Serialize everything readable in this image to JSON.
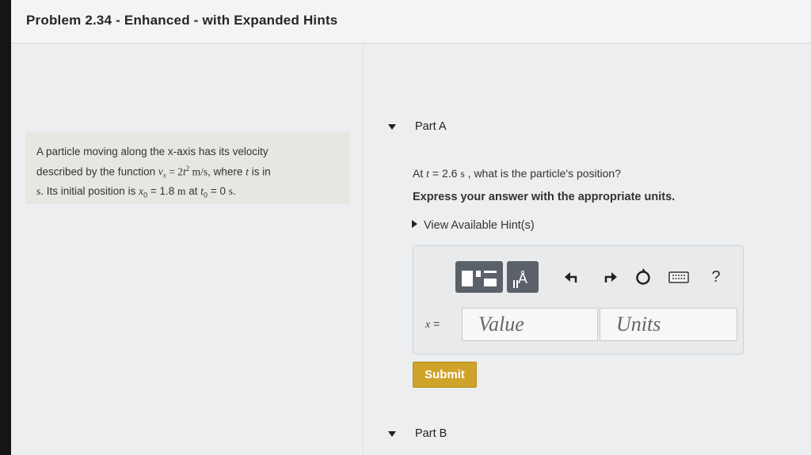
{
  "header": {
    "title": "Problem 2.34 - Enhanced - with Expanded Hints"
  },
  "problem": {
    "line1": "A particle moving along the x-axis has its velocity",
    "line2_a": "described by the function ",
    "vx": "v",
    "vx_sub": "x",
    "eq": " = 2",
    "t_var": "t",
    "t_exp": "2",
    "unit_ms": " m/s",
    "line2_b": ", where ",
    "t_var2": "t",
    "line2_c": " is in",
    "line3_a": "s",
    "line3_b": ". Its initial position is ",
    "x0": "x",
    "x0_sub": "0",
    "x0_val": " = 1.8 ",
    "x0_unit": "m",
    "line3_c": "  at ",
    "t0": "t",
    "t0_sub": "0",
    "t0_val": " = 0 ",
    "t0_unit": "s",
    "line3_end": "."
  },
  "part_a": {
    "label": "Part A",
    "question_prefix": "At ",
    "q_t": "t",
    "q_val": " = 2.6 ",
    "q_unit": "s",
    "question_suffix": " , what is the particle's position?",
    "instruction": "Express your answer with the appropriate units.",
    "hints_label": "View Available Hint(s)",
    "answer_prefix_var": "x",
    "answer_prefix_eq": " =",
    "value_placeholder": "Value",
    "units_placeholder": "Units",
    "toolbar": {
      "icons": [
        "template-icon",
        "units-icon",
        "undo-icon",
        "redo-icon",
        "reset-icon",
        "keyboard-icon",
        "help-icon"
      ],
      "units_glyph": "Å",
      "help_glyph": "?"
    },
    "submit_label": "Submit"
  },
  "part_b": {
    "label": "Part B"
  },
  "colors": {
    "submit": "#cfa22a",
    "toolbar_button": "#5a6168",
    "problem_bg": "#e5e8e2"
  }
}
